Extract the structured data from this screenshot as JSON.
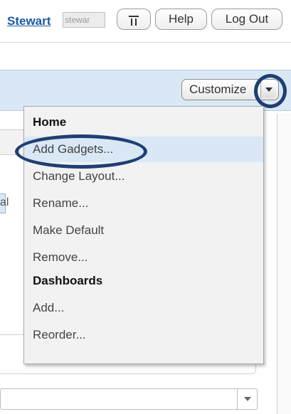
{
  "topbar": {
    "user_name": "Stewart",
    "user_field": "stewar",
    "help_label": "Help",
    "logout_label": "Log Out"
  },
  "dashboard": {
    "customize_label": "Customize"
  },
  "background": {
    "fragment_text": "al"
  },
  "menu": {
    "items": [
      {
        "label": "Home",
        "kind": "heading"
      },
      {
        "label": "Add Gadgets...",
        "kind": "item",
        "active": true
      },
      {
        "label": "Change Layout...",
        "kind": "item"
      },
      {
        "label": "Rename...",
        "kind": "item"
      },
      {
        "label": "Make Default",
        "kind": "item"
      },
      {
        "label": "Remove...",
        "kind": "item"
      },
      {
        "label": "Dashboards",
        "kind": "heading"
      },
      {
        "label": "Add...",
        "kind": "item"
      },
      {
        "label": "Reorder...",
        "kind": "item"
      }
    ]
  },
  "icons": {
    "settings_icon": "bars-icon",
    "dropdown_icon": "triangle-down-icon"
  },
  "colors": {
    "link": "#1a5aa8",
    "header_bg": "#d9e8f4",
    "highlight_ring": "#1f3f72"
  }
}
